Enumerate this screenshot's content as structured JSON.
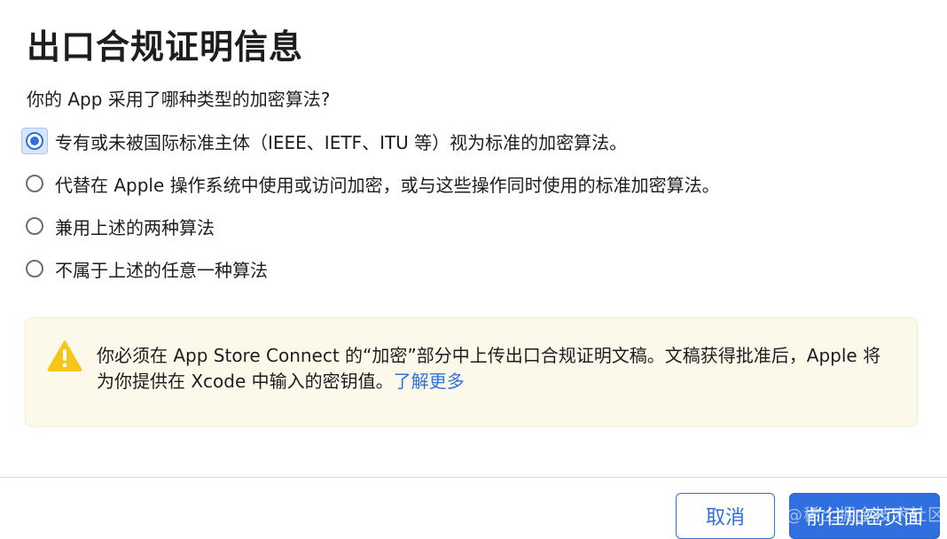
{
  "dialog": {
    "title": "出口合规证明信息",
    "question": "你的 App 采用了哪种类型的加密算法?"
  },
  "options": [
    {
      "label": "专有或未被国际标准主体（IEEE、IETF、ITU 等）视为标准的加密算法。",
      "selected": true
    },
    {
      "label": "代替在 Apple 操作系统中使用或访问加密，或与这些操作同时使用的标准加密算法。",
      "selected": false
    },
    {
      "label": "兼用上述的两种算法",
      "selected": false
    },
    {
      "label": "不属于上述的任意一种算法",
      "selected": false
    }
  ],
  "notice": {
    "icon": "warning-icon",
    "text": "你必须在 App Store Connect 的“加密”部分中上传出口合规证明文稿。文稿获得批准后，Apple 将为你提供在 Xcode 中输入的密钥值。",
    "link_label": "了解更多"
  },
  "footer": {
    "cancel_label": "取消",
    "primary_label": "前往加密页面"
  },
  "watermark": "@稀土掘金技术社区",
  "colors": {
    "accent": "#2f6fe0",
    "warning": "#f5c518",
    "notice_bg": "#fdf9ea"
  }
}
